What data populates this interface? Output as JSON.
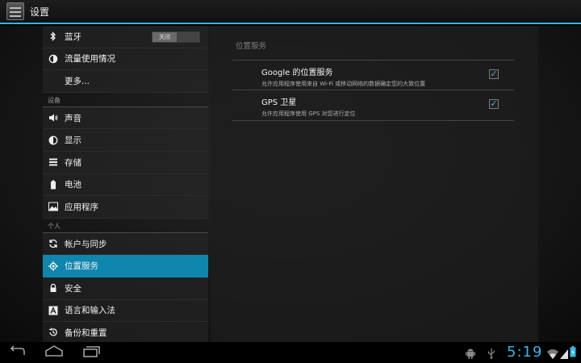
{
  "actionbar": {
    "title": "设置"
  },
  "sidebar": {
    "top_items": [
      {
        "label": "蓝牙",
        "icon": "bluetooth-icon",
        "toggle": "关闭"
      },
      {
        "label": "流量使用情况",
        "icon": "data-usage-icon"
      },
      {
        "label": "更多..."
      }
    ],
    "header_device": "设备",
    "device_items": [
      {
        "label": "声音",
        "icon": "speaker-icon"
      },
      {
        "label": "显示",
        "icon": "brightness-icon"
      },
      {
        "label": "存储",
        "icon": "storage-icon"
      },
      {
        "label": "电池",
        "icon": "battery-icon"
      },
      {
        "label": "应用程序",
        "icon": "apps-icon"
      }
    ],
    "header_personal": "个人",
    "personal_items": [
      {
        "label": "帐户与同步",
        "icon": "sync-icon"
      },
      {
        "label": "位置服务",
        "icon": "location-icon",
        "active": true
      },
      {
        "label": "安全",
        "icon": "lock-icon"
      },
      {
        "label": "语言和输入法",
        "icon": "language-icon"
      },
      {
        "label": "备份和重置",
        "icon": "backup-icon"
      }
    ]
  },
  "panel": {
    "title": "位置服务",
    "prefs": [
      {
        "title": "Google 的位置服务",
        "summary": "允许应用程序使用来自 Wi-Fi 或移动网络的数据确定您的大致位置",
        "checked": true
      },
      {
        "title": "GPS 卫星",
        "summary": "允许应用程序使用 GPS 对您进行定位",
        "checked": true
      }
    ]
  },
  "statusbar": {
    "time": "5:19"
  },
  "colors": {
    "accent": "#33b5e5",
    "selected": "#0f86ad"
  }
}
